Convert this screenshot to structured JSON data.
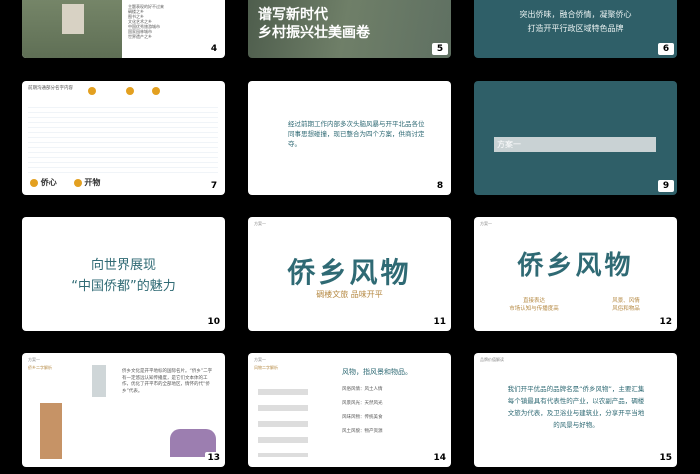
{
  "slides": [
    {
      "num": "4",
      "list": [
        "主题表现的好不过来",
        "碉楼之乡",
        "图书之乡",
        "文化艺术之乡",
        "中国优秀旅游城市",
        "国家园林城市",
        "世界遗产之乡"
      ]
    },
    {
      "num": "5",
      "title1": "谱写新时代",
      "title2": "乡村振兴壮美画卷"
    },
    {
      "num": "6",
      "line1": "突出侨味，融合侨情，凝聚侨心",
      "line2": "打造开平行政区域特色品牌"
    },
    {
      "num": "7",
      "title": "前期沟通部分名字内容",
      "label1": "侨心",
      "label2": "开物"
    },
    {
      "num": "8",
      "text": "经过前期工作内部多次头脑风暴与开平北品各位同事思想碰撞，现已整合为四个方案，供商讨定夺。"
    },
    {
      "num": "9",
      "label": "方案一"
    },
    {
      "num": "10",
      "line1": "向世界展现",
      "line2": "“中国侨都”的魅力"
    },
    {
      "num": "11",
      "tag": "方案一",
      "brand": "侨乡风物",
      "sub": "碉楼文旅 品味开平"
    },
    {
      "num": "12",
      "tag": "方案一",
      "brand": "侨乡风物",
      "left1": "直接表达",
      "left2": "市场认知与传播度高",
      "right1": "风景、风情",
      "right2": "风俗和物品"
    },
    {
      "num": "13",
      "tag": "方案一",
      "sub": "侨乡二字解析",
      "text": "侨乡文化是开平地标的国际名片。“侨乡”二字有一定悠远认知传播度，是它们文本体的工作，优化了开平市的全部地区，情怀的代“侨乡”代表。"
    },
    {
      "num": "14",
      "tag": "方案一",
      "sub": "风物二字解析",
      "head": "风物，指风景和物品。",
      "items": [
        "风俗风情：风土人情",
        "风景风光：天然风光",
        "风味风物：传统美食",
        "风土风貌：物产资源"
      ]
    },
    {
      "num": "15",
      "tag": "品牌价值解读",
      "text": "我们开平优品的品牌名是“侨乡风物”，主要汇集每个镇最具有代表性的产业，以农副产品，碉楼文旅为代表，及卫浴业与建筑业，分享开平当地的风景与好物。"
    }
  ]
}
